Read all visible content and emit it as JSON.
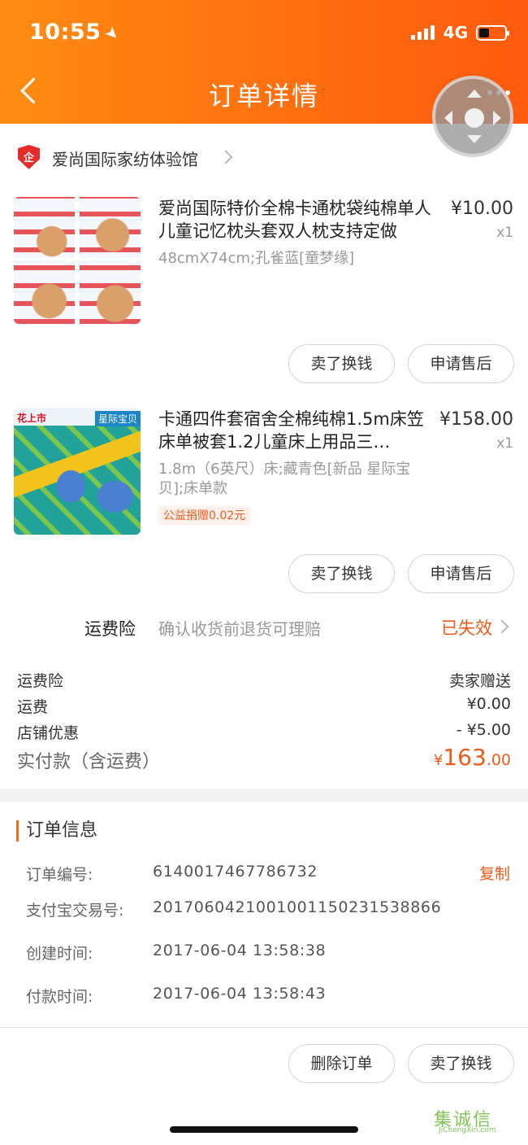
{
  "status_bar": {
    "time": "10:55",
    "network": "4G"
  },
  "header": {
    "title": "订单详情"
  },
  "shop": {
    "icon_text": "企",
    "name": "爱尚国际家纺体验馆"
  },
  "products": [
    {
      "title": "爱尚国际特价全棉卡通枕袋纯棉单人儿童记忆枕头套双人枕支持定做",
      "price": "¥10.00",
      "qty": "x1",
      "sku": "48cmX74cm;孔雀蓝[童梦缘]",
      "buttons": [
        "卖了换钱",
        "申请售后"
      ]
    },
    {
      "title": "卡通四件套宿舍全棉纯棉1.5m床笠床单被套1.2儿童床上用品三…",
      "price": "¥158.00",
      "qty": "x1",
      "sku": "1.8m（6英尺）床;藏青色[新品 星际宝贝];床单款",
      "badge": "公益捐赠0.02元",
      "image_tags": [
        "花上市",
        "星际宝贝"
      ],
      "buttons": [
        "卖了换钱",
        "申请售后"
      ]
    }
  ],
  "freight_insurance": {
    "label": "运费险",
    "desc": "确认收货前退货可理赔",
    "status": "已失效"
  },
  "summary": {
    "rows": [
      {
        "label": "运费险",
        "value": "卖家赠送"
      },
      {
        "label": "运费",
        "value": "¥0.00"
      },
      {
        "label": "店铺优惠",
        "value": "- ¥5.00"
      }
    ],
    "total_label": "实付款（含运费）",
    "total_symbol": "¥",
    "total_int": "163",
    "total_dec": ".00"
  },
  "order_info": {
    "title": "订单信息",
    "copy_label": "复制",
    "rows": [
      {
        "label": "订单编号:",
        "value": "6140017467786732"
      },
      {
        "label": "支付宝交易号:",
        "value": "2017060421001001150231538866"
      },
      {
        "label": "创建时间:",
        "value": "2017-06-04 13:58:38"
      },
      {
        "label": "付款时间:",
        "value": "2017-06-04 13:58:43"
      }
    ]
  },
  "footer_buttons": [
    "删除订单",
    "卖了换钱"
  ],
  "watermark": {
    "main": "集诚信",
    "sub": "JiChengXin.com"
  },
  "colors": {
    "accent": "#f05a1a",
    "header_start": "#ff8c12",
    "header_end": "#ff5a0e"
  }
}
